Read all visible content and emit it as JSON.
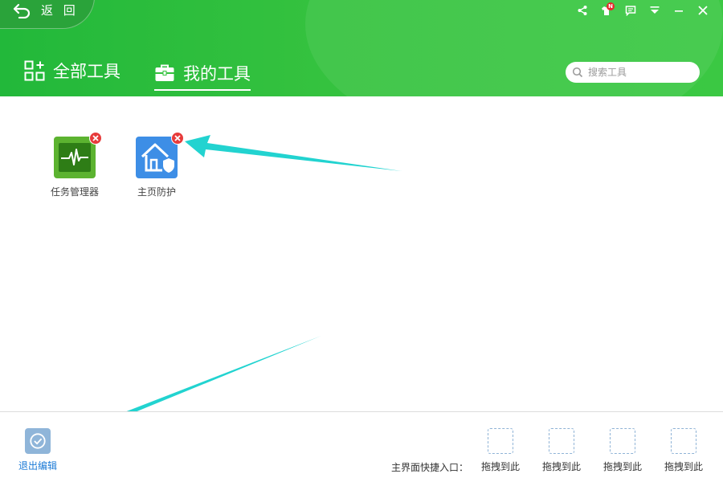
{
  "header": {
    "back_label": "返 回",
    "tabs": [
      {
        "label": "全部工具",
        "icon": "grid-icon",
        "active": false
      },
      {
        "label": "我的工具",
        "icon": "toolbox-icon",
        "active": true
      }
    ],
    "search": {
      "placeholder": "搜索工具"
    },
    "window_controls": {
      "badge": "N"
    }
  },
  "tools": [
    {
      "name": "任务管理器",
      "icon": "task-manager-icon",
      "color": "#5cb330"
    },
    {
      "name": "主页防护",
      "icon": "home-protect-icon",
      "color": "#3d8ee6"
    }
  ],
  "bottom": {
    "exit_edit_label": "退出编辑",
    "shortcut_label": "主界面快捷入口：",
    "slots": [
      "拖拽到此",
      "拖拽到此",
      "拖拽到此",
      "拖拽到此"
    ]
  },
  "colors": {
    "header_green": "#35c23f",
    "delete_red": "#e73b3b",
    "link_blue": "#1b7ad6",
    "arrow_cyan": "#22d3d0"
  }
}
